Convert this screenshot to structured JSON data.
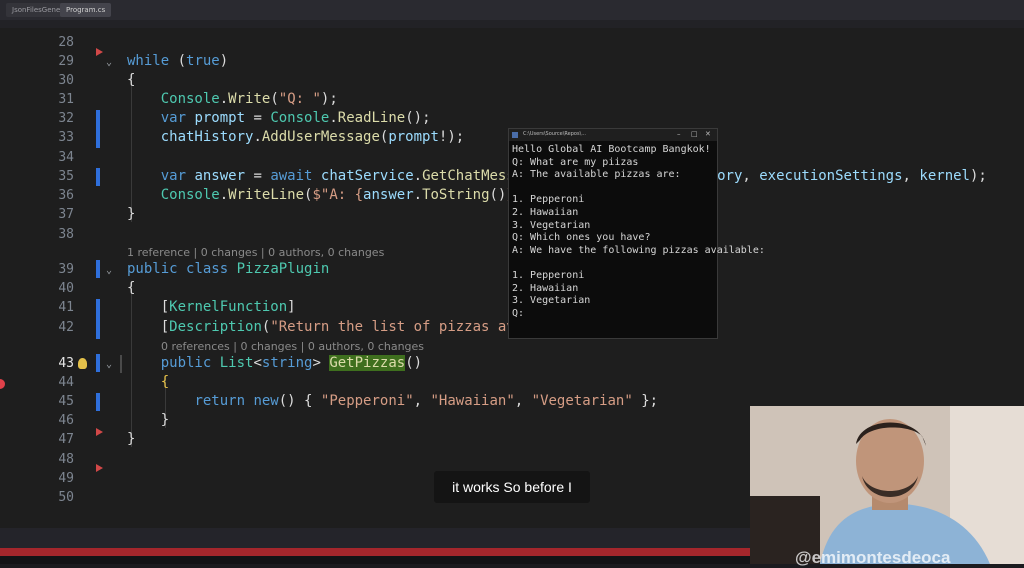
{
  "tabs": [
    "JsonFilesGenerat...",
    "Program.cs"
  ],
  "code_lens": {
    "line39": "1 reference | 0 changes | 0 authors, 0 changes",
    "line43": "0 references | 0 changes | 0 authors, 0 changes"
  },
  "line_numbers": [
    "28",
    "29",
    "30",
    "31",
    "32",
    "33",
    "34",
    "35",
    "36",
    "37",
    "38",
    "39",
    "40",
    "41",
    "42",
    "43",
    "44",
    "45",
    "46",
    "47",
    "48",
    "49",
    "50"
  ],
  "console": {
    "title": "C:\\Users\\Source\\Repos\\...",
    "lines": [
      "Hello Global AI Bootcamp Bangkok!",
      "Q: What are my piizas",
      "A: The available pizzas are:",
      "",
      "1. Pepperoni",
      "2. Hawaiian",
      "3. Vegetarian",
      "Q: Which ones you have?",
      "A: We have the following pizzas available:",
      "",
      "1. Pepperoni",
      "2. Hawaiian",
      "3. Vegetarian",
      "Q:"
    ]
  },
  "subtitle": "it works So before I",
  "webcam": {
    "handle": "@emimontesdeoca"
  },
  "colors": {
    "keyword": "#569cd6",
    "type": "#4ec9b0",
    "method": "#dcdcaa",
    "string": "#d69d85",
    "change_marker": "#2f6fdb",
    "breakpoint": "#e0414a"
  }
}
